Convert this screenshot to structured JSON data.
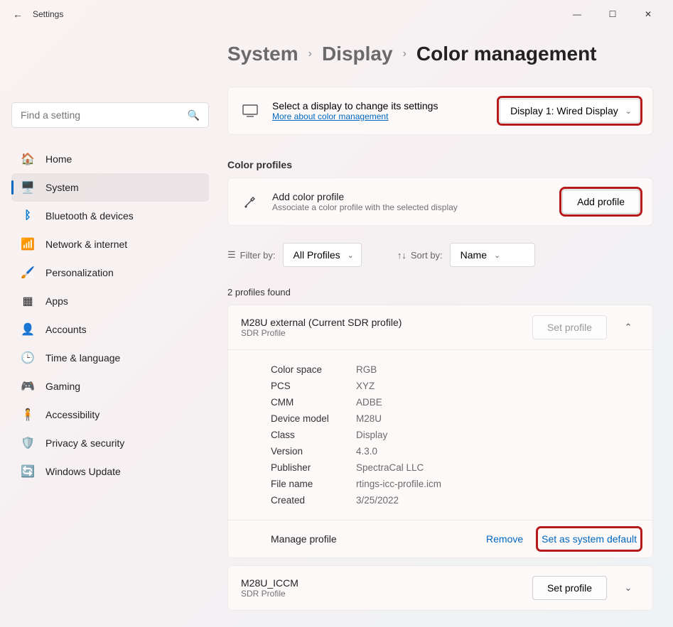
{
  "window": {
    "title": "Settings"
  },
  "search": {
    "placeholder": "Find a setting"
  },
  "sidebar": {
    "items": [
      {
        "label": "Home",
        "icon": "🏠"
      },
      {
        "label": "System",
        "icon": "🖥️"
      },
      {
        "label": "Bluetooth & devices",
        "icon": "ᛒ"
      },
      {
        "label": "Network & internet",
        "icon": "📶"
      },
      {
        "label": "Personalization",
        "icon": "🖌️"
      },
      {
        "label": "Apps",
        "icon": "▦"
      },
      {
        "label": "Accounts",
        "icon": "👤"
      },
      {
        "label": "Time & language",
        "icon": "🕒"
      },
      {
        "label": "Gaming",
        "icon": "🎮"
      },
      {
        "label": "Accessibility",
        "icon": "🧍"
      },
      {
        "label": "Privacy & security",
        "icon": "🛡️"
      },
      {
        "label": "Windows Update",
        "icon": "🔄"
      }
    ]
  },
  "breadcrumb": {
    "l1": "System",
    "l2": "Display",
    "l3": "Color management"
  },
  "display_selector": {
    "title": "Select a display to change its settings",
    "link": "More about color management",
    "selected": "Display 1: Wired Display"
  },
  "section_profiles": "Color profiles",
  "add_profile": {
    "title": "Add color profile",
    "sub": "Associate a color profile with the selected display",
    "button": "Add profile"
  },
  "filters": {
    "filter_label": "Filter by:",
    "filter_value": "All Profiles",
    "sort_label": "Sort by:",
    "sort_value": "Name"
  },
  "count": "2 profiles found",
  "profiles": [
    {
      "name": "M28U external (Current SDR profile)",
      "sub": "SDR Profile",
      "set_btn": "Set profile",
      "set_disabled": true,
      "expanded": true,
      "details": [
        {
          "k": "Color space",
          "v": "RGB"
        },
        {
          "k": "PCS",
          "v": "XYZ"
        },
        {
          "k": "CMM",
          "v": "ADBE"
        },
        {
          "k": "Device model",
          "v": "M28U"
        },
        {
          "k": "Class",
          "v": "Display"
        },
        {
          "k": "Version",
          "v": "4.3.0"
        },
        {
          "k": "Publisher",
          "v": "SpectraCal LLC"
        },
        {
          "k": "File name",
          "v": "rtings-icc-profile.icm"
        },
        {
          "k": "Created",
          "v": "3/25/2022"
        }
      ],
      "manage": {
        "title": "Manage profile",
        "remove": "Remove",
        "default": "Set as system default"
      }
    },
    {
      "name": "M28U_ICCM",
      "sub": "SDR Profile",
      "set_btn": "Set profile",
      "set_disabled": false,
      "expanded": false
    }
  ]
}
